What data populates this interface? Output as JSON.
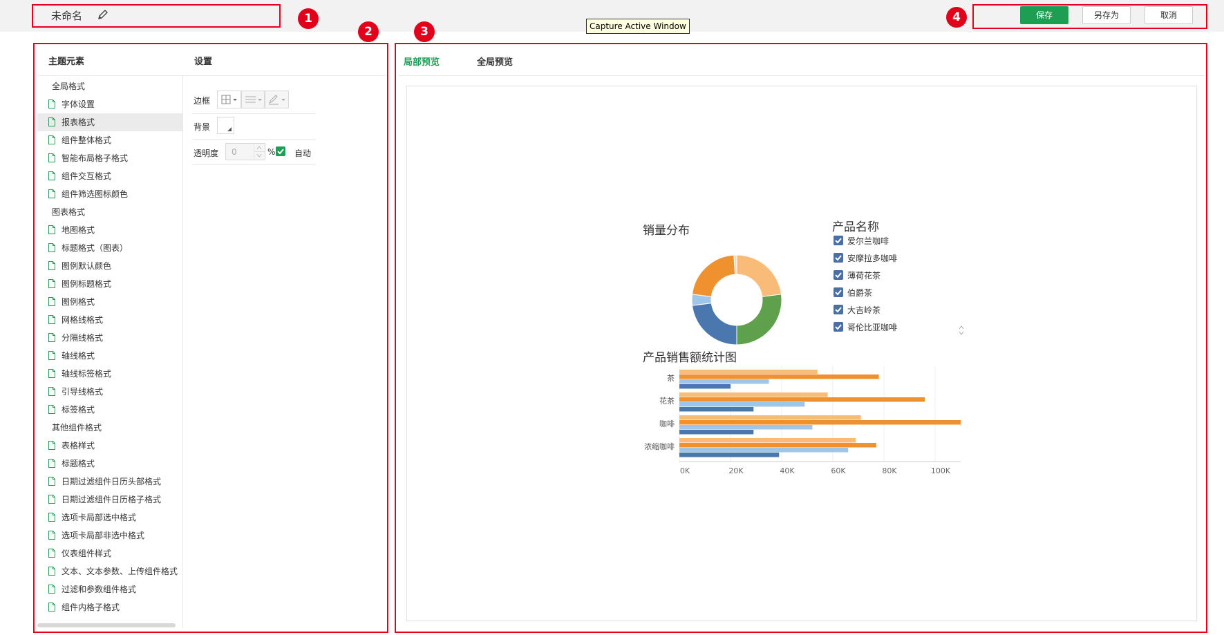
{
  "header": {
    "doc_title": "未命名",
    "tooltip": "Capture Active Window",
    "save_label": "保存",
    "save_as_label": "另存为",
    "cancel_label": "取消",
    "accent_color": "#1e9e53",
    "annotation_color": "#e3001b"
  },
  "annotations": [
    "1",
    "2",
    "3",
    "4"
  ],
  "left_panel": {
    "theme_header": "主题元素",
    "settings_header": "设置",
    "tree": [
      {
        "label": "全局格式",
        "type": "group"
      },
      {
        "label": "字体设置",
        "type": "item"
      },
      {
        "label": "报表格式",
        "type": "item",
        "selected": true
      },
      {
        "label": "组件整体格式",
        "type": "item"
      },
      {
        "label": "智能布局格子格式",
        "type": "item"
      },
      {
        "label": "组件交互格式",
        "type": "item"
      },
      {
        "label": "组件筛选图标颜色",
        "type": "item"
      },
      {
        "label": "图表格式",
        "type": "group"
      },
      {
        "label": "地图格式",
        "type": "item"
      },
      {
        "label": "标题格式（图表）",
        "type": "item"
      },
      {
        "label": "图例默认颜色",
        "type": "item"
      },
      {
        "label": "图例标题格式",
        "type": "item"
      },
      {
        "label": "图例格式",
        "type": "item"
      },
      {
        "label": "网格线格式",
        "type": "item"
      },
      {
        "label": "分隔线格式",
        "type": "item"
      },
      {
        "label": "轴线格式",
        "type": "item"
      },
      {
        "label": "轴线标签格式",
        "type": "item"
      },
      {
        "label": "引导线格式",
        "type": "item"
      },
      {
        "label": "标签格式",
        "type": "item"
      },
      {
        "label": "其他组件格式",
        "type": "group"
      },
      {
        "label": "表格样式",
        "type": "item"
      },
      {
        "label": "标题格式",
        "type": "item"
      },
      {
        "label": "日期过滤组件日历头部格式",
        "type": "item"
      },
      {
        "label": "日期过滤组件日历格子格式",
        "type": "item"
      },
      {
        "label": "选项卡局部选中格式",
        "type": "item"
      },
      {
        "label": "选项卡局部非选中格式",
        "type": "item"
      },
      {
        "label": "仪表组件样式",
        "type": "item"
      },
      {
        "label": "文本、文本参数、上传组件格式",
        "type": "item"
      },
      {
        "label": "过滤和参数组件格式",
        "type": "item"
      },
      {
        "label": "组件内格子格式",
        "type": "item"
      }
    ],
    "settings": {
      "border_label": "边框",
      "background_label": "背景",
      "opacity_label": "透明度",
      "opacity_value": "0",
      "percent_sign": "%",
      "auto_label": "自动",
      "auto_checked": true
    }
  },
  "preview": {
    "tab_local": "局部预览",
    "tab_global": "全局预览",
    "active_tab": "局部预览"
  },
  "chart_data": [
    {
      "type": "pie",
      "title": "销量分布",
      "donut": true,
      "legend_title": "产品名称",
      "legend_position": "right",
      "categories": [
        "爱尔兰咖啡",
        "安摩拉多咖啡",
        "薄荷花茶",
        "伯爵茶",
        "大吉岭茶",
        "哥伦比亚咖啡"
      ],
      "values": [
        23,
        27,
        23,
        4,
        22,
        1
      ],
      "colors": [
        "#f9bb78",
        "#5ea04c",
        "#4a78ae",
        "#9fc6e6",
        "#f0912f",
        "#f5d9a8"
      ],
      "legend_checked": [
        true,
        true,
        true,
        true,
        true,
        true
      ]
    },
    {
      "type": "bar",
      "orientation": "horizontal",
      "title": "产品销售额统计图",
      "categories": [
        "茶",
        "花茶",
        "咖啡",
        "浓缩咖啡"
      ],
      "series": [
        {
          "values": [
            54000,
            58000,
            71000,
            69000
          ],
          "color": "#f9bb78"
        },
        {
          "values": [
            78000,
            96000,
            110000,
            77000
          ],
          "color": "#f0912f"
        },
        {
          "values": [
            35000,
            49000,
            52000,
            66000
          ],
          "color": "#9fc6e6"
        },
        {
          "values": [
            20000,
            29000,
            29000,
            39000
          ],
          "color": "#4a78ae"
        }
      ],
      "xlim": [
        0,
        110000
      ],
      "xticks": [
        "0K",
        "20K",
        "40K",
        "60K",
        "80K",
        "100K"
      ],
      "xtick_values": [
        0,
        20000,
        40000,
        60000,
        80000,
        100000
      ],
      "grid": true
    }
  ]
}
